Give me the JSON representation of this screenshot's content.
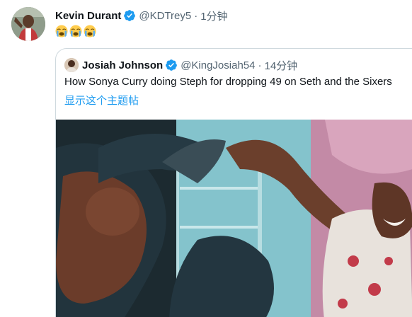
{
  "tweet": {
    "author_name": "Kevin Durant",
    "author_handle": "@KDTrey5",
    "separator": "·",
    "time": "1分钟",
    "emojis": [
      "loudly-crying-face-emoji",
      "loudly-crying-face-emoji",
      "loudly-crying-face-emoji"
    ]
  },
  "quoted": {
    "author_name": "Josiah Johnson",
    "author_handle": "@KingJosiah54",
    "separator": "·",
    "time": "14分钟",
    "text": "How Sonya Curry doing Steph for dropping 49 on Seth and the Sixers",
    "show_thread": "显示这个主题帖",
    "media_icon": "video-still"
  },
  "colors": {
    "link": "#1d9bf0",
    "verified": "#1d9bf0",
    "secondary_text": "#536471",
    "border": "#cfd9de"
  }
}
